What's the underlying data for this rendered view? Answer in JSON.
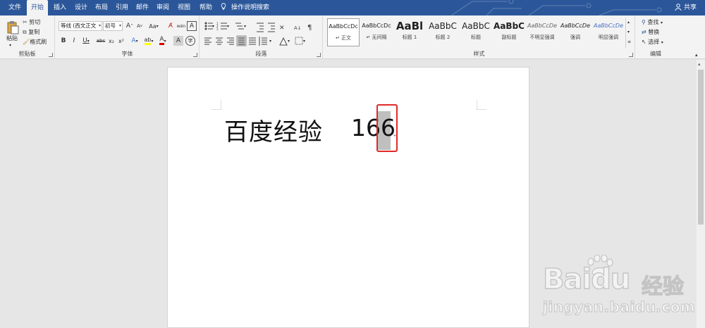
{
  "tabs": [
    {
      "label": "文件",
      "active": false
    },
    {
      "label": "开始",
      "active": true
    },
    {
      "label": "插入",
      "active": false
    },
    {
      "label": "设计",
      "active": false
    },
    {
      "label": "布局",
      "active": false
    },
    {
      "label": "引用",
      "active": false
    },
    {
      "label": "邮件",
      "active": false
    },
    {
      "label": "审阅",
      "active": false
    },
    {
      "label": "视图",
      "active": false
    },
    {
      "label": "帮助",
      "active": false
    }
  ],
  "tell_me": "操作说明搜索",
  "share": "共享",
  "clipboard": {
    "paste": "粘贴",
    "cut": "剪切",
    "copy": "复制",
    "format_painter": "格式刷",
    "label": "剪贴板"
  },
  "font": {
    "font_name": "等线 (西文正文",
    "font_size": "初号",
    "label": "字体",
    "bold": "B",
    "italic": "I",
    "underline": "U",
    "strike": "abc",
    "subscript": "x₂",
    "superscript": "x²",
    "grow": "A",
    "shrink": "A",
    "change_case": "Aa",
    "text_effect": "A",
    "font_color": "A",
    "char_border": "A",
    "char_shading": "A",
    "phonetic": "wén",
    "enclose": "字"
  },
  "paragraph": {
    "label": "段落"
  },
  "styles": {
    "label": "样式",
    "items": [
      {
        "preview": "AaBbCcDc",
        "name": "↵ 正文",
        "selected": true
      },
      {
        "preview": "AaBbCcDc",
        "name": "↵ 无间隔",
        "selected": false
      },
      {
        "preview": "AaBl",
        "name": "标题 1",
        "selected": false
      },
      {
        "preview": "AaBbC",
        "name": "标题 2",
        "selected": false
      },
      {
        "preview": "AaBbC",
        "name": "标题",
        "selected": false
      },
      {
        "preview": "AaBbC",
        "name": "副标题",
        "selected": false
      },
      {
        "preview": "AaBbCcDe",
        "name": "不明显强调",
        "selected": false
      },
      {
        "preview": "AaBbCcDe",
        "name": "强调",
        "selected": false
      },
      {
        "preview": "AaBbCcDe",
        "name": "明显强调",
        "selected": false
      }
    ]
  },
  "editing": {
    "label": "编辑",
    "find": "查找",
    "replace": "替换",
    "select": "选择"
  },
  "document": {
    "text": "百度经验",
    "number_prefix": "16",
    "number_selected": "6",
    "para_mark": "↵"
  },
  "watermark": {
    "brand": "Bai",
    "brand2": "du",
    "brand_cn": "经验",
    "url": "jingyan.baidu.com"
  },
  "colors": {
    "tab_bar": "#2b579a",
    "ribbon": "#f3f3f3",
    "highlight_red": "#e02a2a",
    "font_color_red": "#e00000",
    "highlight_yellow": "#ffff00"
  }
}
